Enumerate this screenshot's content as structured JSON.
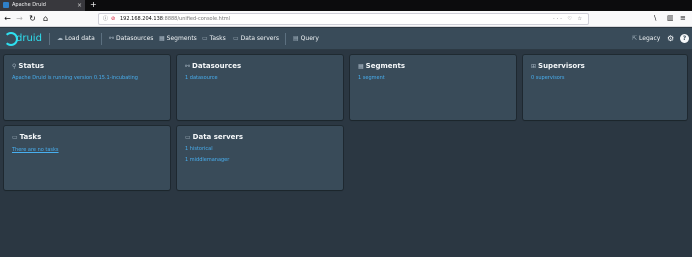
{
  "browser": {
    "tab_title": "Apache Druid",
    "tab_close": "×",
    "new_tab": "+",
    "url_host": "192.168.204.138",
    "url_path": ":8888/unified-console.html",
    "back": "←",
    "forward": "→",
    "reload": "↻",
    "home": "⌂",
    "url_actions": "··· ♡ ☆",
    "library": "\\",
    "sidebar_toggle": "▥",
    "menu": "≡"
  },
  "header": {
    "logo_text": "druid",
    "nav": [
      {
        "label": "Load data",
        "icon": "☁"
      },
      {
        "label": "Datasources",
        "icon": "⚯"
      },
      {
        "label": "Segments",
        "icon": "▦"
      },
      {
        "label": "Tasks",
        "icon": "▭"
      },
      {
        "label": "Data servers",
        "icon": "▭"
      },
      {
        "label": "Query",
        "icon": "▤"
      }
    ],
    "legacy": {
      "label": "Legacy",
      "icon": "⇱"
    },
    "settings_icon": "⚙",
    "help_icon": "?"
  },
  "cards": {
    "status": {
      "title": "Status",
      "icon": "⚲",
      "line1": "Apache Druid is running version 0.15.1-incubating"
    },
    "datasources": {
      "title": "Datasources",
      "icon": "⚯",
      "line1": "1 datasource"
    },
    "segments": {
      "title": "Segments",
      "icon": "▦",
      "line1": "1 segment"
    },
    "supervisors": {
      "title": "Supervisors",
      "icon": "⊞",
      "line1": "0 supervisors"
    },
    "tasks": {
      "title": "Tasks",
      "icon": "▭",
      "line1": "There are no tasks"
    },
    "data_servers": {
      "title": "Data servers",
      "icon": "▭",
      "line1": "1 historical",
      "line2": "1 middlemanager"
    }
  }
}
